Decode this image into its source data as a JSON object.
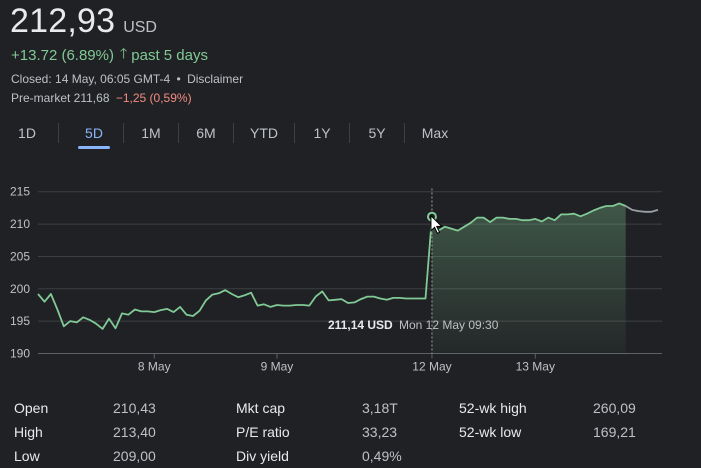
{
  "quote": {
    "price": "212,93",
    "currency": "USD",
    "change": "+13.72 (6.89%)",
    "period": "past 5 days",
    "closed": "Closed: 14 May, 06:05 GMT-4",
    "bullet": "•",
    "disclaimer": "Disclaimer",
    "premarket_label": "Pre-market 211,68",
    "premarket_change": "−1,25 (0,59%)",
    "up_color": "#81c995",
    "down_color": "#f28b82"
  },
  "tabs": [
    {
      "label": "1D"
    },
    {
      "label": "5D",
      "active": true
    },
    {
      "label": "1M"
    },
    {
      "label": "6M"
    },
    {
      "label": "YTD"
    },
    {
      "label": "1Y"
    },
    {
      "label": "5Y"
    },
    {
      "label": "Max"
    }
  ],
  "chart_data": {
    "type": "line",
    "y_ticks": [
      190,
      195,
      200,
      205,
      210,
      215
    ],
    "ylim": [
      190,
      215.5
    ],
    "x_labels": [
      "8 May",
      "9 May",
      "12 May",
      "13 May"
    ],
    "x": [
      0,
      1,
      2,
      3,
      4,
      5,
      6,
      7,
      8,
      9,
      10,
      11,
      12,
      13,
      14,
      15,
      16,
      17,
      18,
      19,
      20,
      21,
      22,
      23,
      24,
      25,
      26,
      27,
      28,
      29,
      30,
      31,
      32,
      33,
      34,
      35,
      36,
      37,
      38,
      39,
      40,
      41,
      42,
      43,
      44,
      45,
      46,
      47,
      48,
      49,
      50,
      51,
      52,
      53,
      54,
      55,
      56,
      57,
      58,
      59,
      60,
      61,
      62,
      63,
      64,
      65,
      66,
      67,
      68,
      69,
      70,
      71,
      72,
      73,
      74,
      75,
      76,
      77,
      78,
      79,
      80,
      81,
      82,
      83,
      84,
      85,
      86,
      87,
      88,
      89,
      90,
      91,
      92,
      93,
      94,
      95,
      96
    ],
    "values": [
      199.2,
      198.0,
      199.2,
      196.8,
      194.2,
      195.0,
      194.8,
      195.6,
      195.2,
      194.6,
      193.8,
      195.4,
      193.9,
      196.2,
      196.0,
      196.8,
      196.5,
      196.5,
      196.4,
      196.7,
      196.9,
      196.4,
      197.2,
      196.0,
      195.8,
      196.6,
      198.2,
      199.1,
      199.3,
      199.8,
      199.2,
      198.7,
      199.0,
      199.4,
      197.4,
      197.6,
      197.2,
      197.5,
      197.4,
      197.4,
      197.5,
      197.5,
      197.4,
      198.8,
      199.6,
      198.2,
      198.3,
      198.4,
      197.8,
      197.9,
      198.4,
      198.8,
      198.8,
      198.5,
      198.3,
      198.6,
      198.6,
      198.5,
      198.5,
      198.5,
      198.5,
      211.14,
      209.0,
      209.6,
      209.3,
      209.0,
      209.6,
      210.2,
      211.0,
      211.0,
      210.3,
      211.0,
      211.0,
      210.8,
      210.8,
      210.6,
      210.6,
      210.8,
      210.4,
      211.0,
      210.6,
      211.5,
      211.5,
      211.6,
      211.2,
      211.6,
      212.1,
      212.5,
      212.8,
      212.8,
      213.2,
      212.8,
      212.2,
      212.0,
      211.9,
      211.9,
      212.2
    ],
    "x_label_index": [
      18,
      37,
      61,
      77
    ],
    "active_index": 61,
    "highlight_start_index": 61,
    "highlight_end_index": 91,
    "tooltip_price": "211,14 USD",
    "tooltip_time": "Mon 12 May 09:30",
    "line_color": "#81c995",
    "inactive_line_color": "#9aa0a6",
    "grid": true
  },
  "stats": [
    {
      "label": "Open",
      "value": "210,43"
    },
    {
      "label": "High",
      "value": "213,40"
    },
    {
      "label": "Low",
      "value": "209,00"
    },
    {
      "label": "Mkt cap",
      "value": "3,18T"
    },
    {
      "label": "P/E ratio",
      "value": "33,23"
    },
    {
      "label": "Div yield",
      "value": "0,49%"
    },
    {
      "label": "52-wk high",
      "value": "260,09"
    },
    {
      "label": "52-wk low",
      "value": "169,21"
    }
  ]
}
